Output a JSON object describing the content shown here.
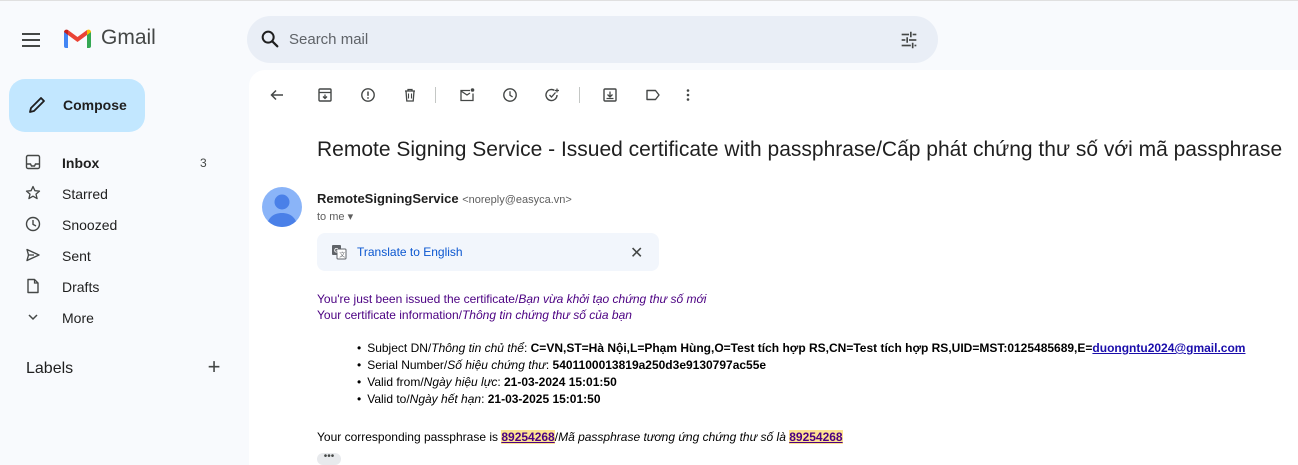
{
  "app": {
    "name": "Gmail"
  },
  "search": {
    "placeholder": "Search mail"
  },
  "sidebar": {
    "compose_label": "Compose",
    "items": [
      {
        "label": "Inbox",
        "count": "3",
        "icon": "inbox-icon"
      },
      {
        "label": "Starred",
        "count": "",
        "icon": "star-icon"
      },
      {
        "label": "Snoozed",
        "count": "",
        "icon": "clock-icon"
      },
      {
        "label": "Sent",
        "count": "",
        "icon": "send-icon"
      },
      {
        "label": "Drafts",
        "count": "",
        "icon": "draft-icon"
      },
      {
        "label": "More",
        "count": "",
        "icon": "chevron-down-icon"
      }
    ],
    "labels_title": "Labels",
    "labels_add": "+"
  },
  "email": {
    "subject": "Remote Signing Service - Issued certificate with passphrase/Cấp phát chứng thư số với mã passphrase",
    "sender_name": "RemoteSigningService",
    "sender_email": "<noreply@easyca.vn>",
    "to": "to me",
    "translate_label": "Translate to English",
    "line1_en": "You're just been issued the certificate/",
    "line1_vi": "Bạn vừa khởi tạo chứng thư số mới",
    "line2_en": "Your certificate information/",
    "line2_vi": "Thông tin chứng thư số của bạn",
    "subject_dn_label_en": "Subject DN/",
    "subject_dn_label_vi": "Thông tin chủ thể",
    "subject_dn_value": "C=VN,ST=Hà Nội,L=Phạm Hùng,O=Test tích hợp RS,CN=Test tích hợp RS,UID=MST:0125485689,E=",
    "subject_dn_email": "duongntu2024@gmail.com",
    "serial_label_en": "Serial Number/",
    "serial_label_vi": "Số hiệu chứng thư",
    "serial_value": "5401100013819a250d3e9130797ac55e",
    "valid_from_label_en": "Valid from/",
    "valid_from_label_vi": "Ngày hiệu lực",
    "valid_from_value": "21-03-2024 15:01:50",
    "valid_to_label_en": "Valid to/",
    "valid_to_label_vi": "Ngày hết hạn",
    "valid_to_value": "21-03-2025 15:01:50",
    "pass_prefix": "Your corresponding passphrase is ",
    "pass_value": "89254268",
    "pass_mid": "Mã passphrase tương ứng chứng thư số là ",
    "more": "•••"
  }
}
